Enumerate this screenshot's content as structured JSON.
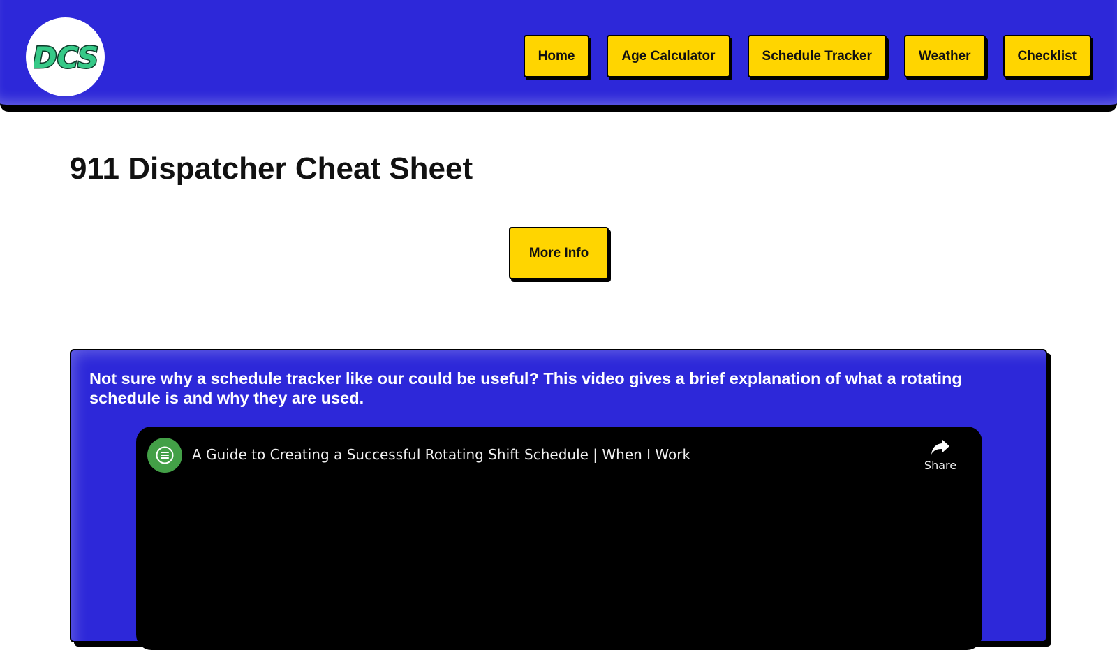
{
  "colors": {
    "header_bg": "#2d28d9",
    "button_bg": "#ffd500",
    "border": "#000000",
    "channel_avatar": "#43a047"
  },
  "header": {
    "logo_text": "DCS",
    "nav": [
      {
        "label": "Home"
      },
      {
        "label": "Age Calculator"
      },
      {
        "label": "Schedule Tracker"
      },
      {
        "label": "Weather"
      },
      {
        "label": "Checklist"
      }
    ]
  },
  "main": {
    "title": "911 Dispatcher Cheat Sheet",
    "more_info_label": "More Info"
  },
  "video_section": {
    "description": "Not sure why a schedule tracker like our could be useful? This video gives a brief explanation of what a rotating schedule is and why they are used.",
    "player": {
      "title": "A Guide to Creating a Successful Rotating Shift Schedule | When I Work",
      "share_label": "Share",
      "channel_icon": "list-icon",
      "share_icon": "share-arrow-icon"
    }
  }
}
